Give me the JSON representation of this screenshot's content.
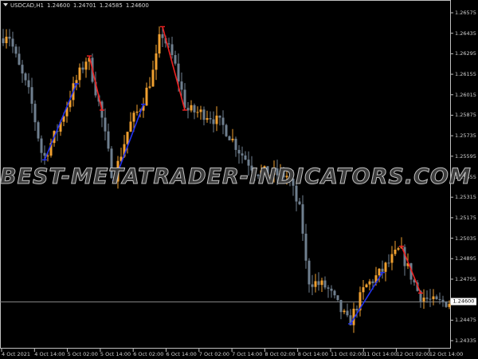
{
  "header": {
    "symbol": "USDCAD,H1",
    "open": "1.24600",
    "high": "1.24701",
    "low": "1.24585",
    "close": "1.24600"
  },
  "colors": {
    "bull": "#f0a030",
    "bear": "#6f7f8f",
    "zigzag_up": "#2233ee",
    "zigzag_down": "#ee2222",
    "grid": "#c0c0c0",
    "current_line": "#8a8a8a"
  },
  "watermark": "BEST-METATRADER-INDICATORS.COM",
  "current_price": "1.24600",
  "chart_data": {
    "type": "candlestick",
    "y_ticks": [
      "1.26575",
      "1.26435",
      "1.26295",
      "1.26155",
      "1.26015",
      "1.25875",
      "1.25735",
      "1.25595",
      "1.25455",
      "1.25315",
      "1.25175",
      "1.25035",
      "1.24895",
      "1.24755",
      "1.24615",
      "1.24475",
      "1.24335"
    ],
    "x_ticks": [
      "4 Oct 2021",
      "4 Oct 14:00",
      "5 Oct 02:00",
      "5 Oct 14:00",
      "6 Oct 02:00",
      "6 Oct 14:00",
      "7 Oct 02:00",
      "7 Oct 14:00",
      "8 Oct 02:00",
      "8 Oct 14:00",
      "11 Oct 02:00",
      "11 Oct 14:00",
      "12 Oct 02:00",
      "12 Oct 14:00"
    ],
    "ylim": [
      1.24265,
      1.26665
    ],
    "price_path": [
      [
        0,
        1.264
      ],
      [
        2,
        1.2645
      ],
      [
        5,
        1.2623
      ],
      [
        9,
        1.26
      ],
      [
        13,
        1.2557
      ],
      [
        18,
        1.258
      ],
      [
        23,
        1.2609
      ],
      [
        27,
        1.2628
      ],
      [
        31,
        1.2591
      ],
      [
        35,
        1.2543
      ],
      [
        40,
        1.258
      ],
      [
        44,
        1.2595
      ],
      [
        48,
        1.262
      ],
      [
        50,
        1.2645
      ],
      [
        54,
        1.2625
      ],
      [
        58,
        1.2591
      ],
      [
        65,
        1.2588
      ],
      [
        70,
        1.2579
      ],
      [
        75,
        1.2562
      ],
      [
        80,
        1.2549
      ],
      [
        90,
        1.2546
      ],
      [
        94,
        1.2519
      ],
      [
        96,
        1.2475
      ],
      [
        102,
        1.247
      ],
      [
        109,
        1.2445
      ],
      [
        114,
        1.247
      ],
      [
        119,
        1.248
      ],
      [
        125,
        1.2496
      ],
      [
        131,
        1.2465
      ],
      [
        136,
        1.2459
      ],
      [
        140,
        1.246
      ]
    ],
    "zigzag": [
      {
        "dir": "up",
        "from": [
          13,
          1.2557
        ],
        "to": [
          23,
          1.2609
        ]
      },
      {
        "dir": "down",
        "from": [
          27,
          1.2628
        ],
        "to": [
          31,
          1.2591
        ]
      },
      {
        "dir": "up",
        "from": [
          35,
          1.2543
        ],
        "to": [
          44,
          1.2595
        ]
      },
      {
        "dir": "down",
        "from": [
          50,
          1.2648
        ],
        "to": [
          57,
          1.2591
        ]
      },
      {
        "dir": "up",
        "from": [
          109,
          1.2445
        ],
        "to": [
          119,
          1.248
        ]
      },
      {
        "dir": "down",
        "from": [
          125,
          1.2498
        ],
        "to": [
          131,
          1.2466
        ]
      }
    ]
  }
}
